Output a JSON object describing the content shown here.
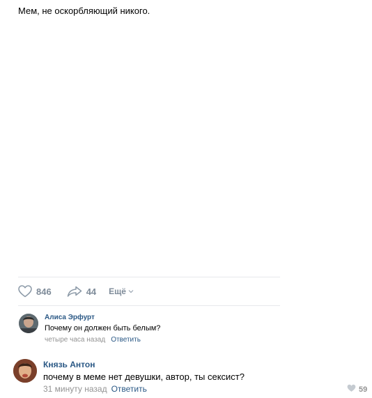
{
  "post": {
    "text": "Мем, не оскорбляющий никого."
  },
  "actions": {
    "likes": "846",
    "shares": "44",
    "more_label": "Ещё"
  },
  "comments": [
    {
      "author": "Алиса Эрфурт",
      "text": "Почему он должен быть белым?",
      "time": "четыре часа назад",
      "reply_label": "Ответить"
    },
    {
      "author": "Князь Антон",
      "text": "почему в меме нет девушки, автор, ты сексист?",
      "time": "31 минуту назад",
      "reply_label": "Ответить",
      "likes": "59"
    }
  ],
  "colors": {
    "link": "#2a5885",
    "meta": "#939393",
    "action": "#7e8b99",
    "divider": "#e7e8ec"
  },
  "icons": {
    "like": "heart-icon",
    "share": "share-arrow-icon",
    "more": "chevron-down-icon"
  }
}
